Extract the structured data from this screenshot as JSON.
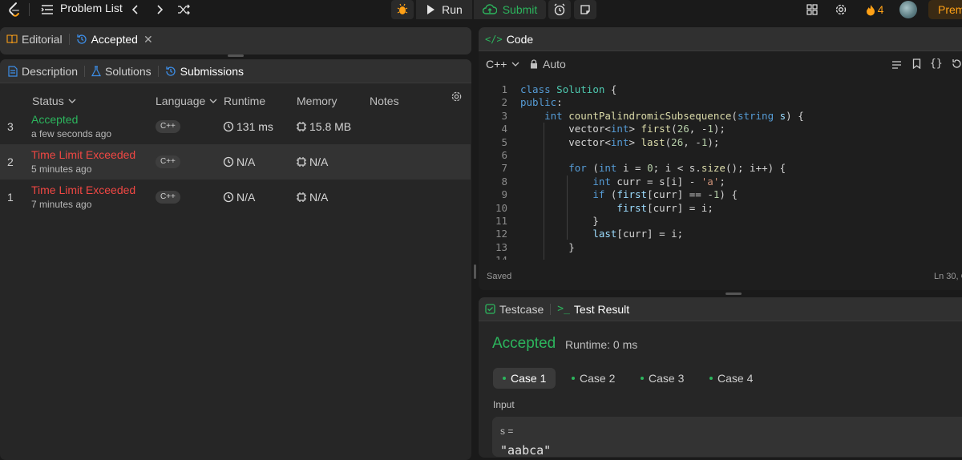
{
  "topbar": {
    "problem_list": "Problem List",
    "run": "Run",
    "submit": "Submit",
    "streak": "4",
    "premium": "Prem"
  },
  "left": {
    "top_tabs": [
      "Editorial",
      "Accepted"
    ],
    "sub_tabs": [
      "Description",
      "Solutions",
      "Submissions"
    ],
    "columns": [
      "Status",
      "Language",
      "Runtime",
      "Memory",
      "Notes"
    ],
    "rows": [
      {
        "idx": "3",
        "status": "Accepted",
        "time": "a few seconds ago",
        "lang": "C++",
        "runtime": "131 ms",
        "memory": "15.8 MB"
      },
      {
        "idx": "2",
        "status": "Time Limit Exceeded",
        "time": "5 minutes ago",
        "lang": "C++",
        "runtime": "N/A",
        "memory": "N/A"
      },
      {
        "idx": "1",
        "status": "Time Limit Exceeded",
        "time": "7 minutes ago",
        "lang": "C++",
        "runtime": "N/A",
        "memory": "N/A"
      }
    ]
  },
  "code": {
    "tab": "Code",
    "language": "C++",
    "auto": "Auto",
    "saved": "Saved",
    "position": "Ln 30, C"
  },
  "result": {
    "tabs": [
      "Testcase",
      "Test Result"
    ],
    "verdict": "Accepted",
    "runtime": "Runtime: 0 ms",
    "cases": [
      "Case 1",
      "Case 2",
      "Case 3",
      "Case 4"
    ],
    "input_label": "Input",
    "var": "s =",
    "value": "\"aabca\""
  },
  "colors": {
    "accent_green": "#2cb55d",
    "error_red": "#ef4743",
    "streak_orange": "#ffa116"
  }
}
